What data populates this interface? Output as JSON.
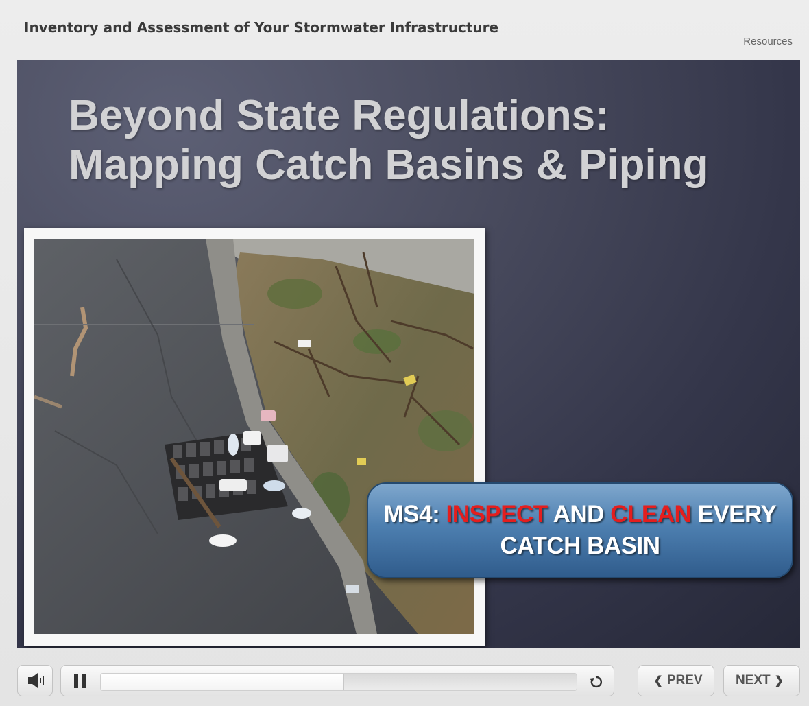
{
  "header": {
    "course_title": "Inventory and Assessment of Your Stormwater Infrastructure",
    "resources_label": "Resources"
  },
  "slide": {
    "title_line1": "Beyond State Regulations:",
    "title_line2": "Mapping Catch Basins & Piping",
    "callout": {
      "prefix": "MS4: ",
      "word1": "INSPECT",
      "middle": " AND ",
      "word2": "CLEAN",
      "suffix": " EVERY",
      "line2": "CATCH BASIN"
    },
    "colors": {
      "highlight": "#e41e1e",
      "callout_blue": "#4d7fb0"
    }
  },
  "controls": {
    "volume_icon": "speaker-icon",
    "pause_icon": "pause-icon",
    "progress_fraction": 0.51,
    "replay_icon": "replay-icon",
    "prev_label": "PREV",
    "next_label": "NEXT"
  }
}
